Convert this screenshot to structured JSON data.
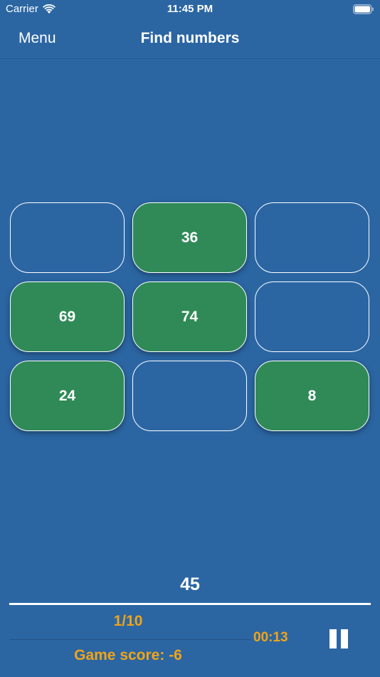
{
  "status_bar": {
    "carrier": "Carrier",
    "time": "11:45 PM",
    "wifi_icon": "wifi-icon",
    "battery_icon": "battery-icon"
  },
  "nav": {
    "menu_label": "Menu",
    "title": "Find numbers"
  },
  "grid": {
    "cells": [
      {
        "value": "",
        "filled": false
      },
      {
        "value": "36",
        "filled": true
      },
      {
        "value": "",
        "filled": false
      },
      {
        "value": "69",
        "filled": true
      },
      {
        "value": "74",
        "filled": true
      },
      {
        "value": "",
        "filled": false
      },
      {
        "value": "24",
        "filled": true
      },
      {
        "value": "",
        "filled": false
      },
      {
        "value": "8",
        "filled": true
      }
    ]
  },
  "game": {
    "target_number": "45",
    "progress": "1/10",
    "timer": "00:13",
    "score_text": "Game score:  -6",
    "pause_icon": "pause-icon"
  },
  "colors": {
    "background": "#2b66a3",
    "filled_cell": "#2f8a57",
    "accent": "#f2a416"
  }
}
